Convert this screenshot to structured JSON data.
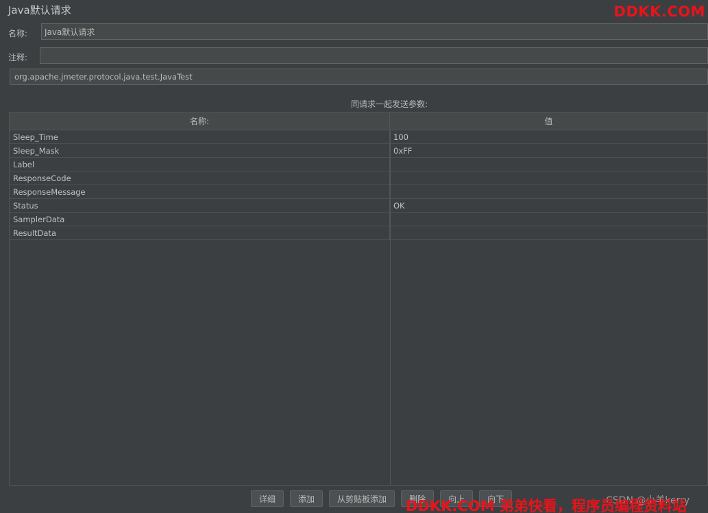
{
  "title": "Java默认请求",
  "name_label": "名称:",
  "name_value": "Java默认请求",
  "comment_label": "注释:",
  "comment_value": "",
  "classname": "org.apache.jmeter.protocol.java.test.JavaTest",
  "params_caption": "同请求一起发送参数:",
  "table": {
    "col_name": "名称:",
    "col_value": "值",
    "rows": [
      {
        "name": "Sleep_Time",
        "value": "100"
      },
      {
        "name": "Sleep_Mask",
        "value": "0xFF"
      },
      {
        "name": "Label",
        "value": ""
      },
      {
        "name": "ResponseCode",
        "value": ""
      },
      {
        "name": "ResponseMessage",
        "value": ""
      },
      {
        "name": "Status",
        "value": "OK"
      },
      {
        "name": "SamplerData",
        "value": ""
      },
      {
        "name": "ResultData",
        "value": ""
      }
    ]
  },
  "buttons": {
    "detail": "详细",
    "add": "添加",
    "add_clipboard": "从剪贴板添加",
    "delete": "删除",
    "up": "向上",
    "down": "向下"
  },
  "watermark_top": "DDKK.COM",
  "credit": "CSDN @小羊kerry",
  "watermark_bottom": "DDKK.COM 弟弟快看，程序员编程资料站"
}
